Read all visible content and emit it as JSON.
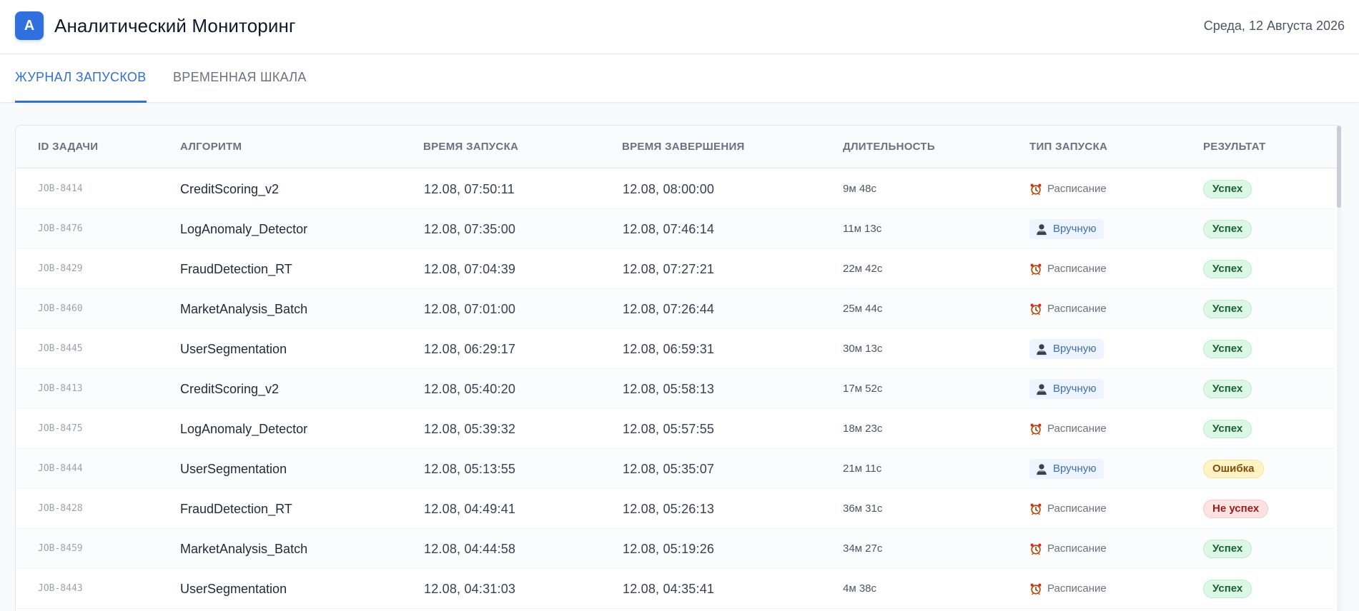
{
  "app": {
    "logo_letter": "А",
    "title": "Аналитический Мониторинг",
    "date": "Среда, 12 Августа 2026"
  },
  "tabs": [
    {
      "label": "ЖУРНАЛ ЗАПУСКОВ",
      "active": true
    },
    {
      "label": "ВРЕМЕННАЯ ШКАЛА",
      "active": false
    }
  ],
  "table": {
    "headers": [
      "ID ЗАДАЧИ",
      "АЛГОРИТМ",
      "ВРЕМЯ ЗАПУСКА",
      "ВРЕМЯ ЗАВЕРШЕНИЯ",
      "ДЛИТЕЛЬНОСТЬ",
      "ТИП ЗАПУСКА",
      "РЕЗУЛЬТАТ"
    ],
    "rows": [
      {
        "id": "JOB-8414",
        "algorithm": "CreditScoring_v2",
        "start": "12.08, 07:50:11",
        "end": "12.08, 08:00:00",
        "duration": "9м 48с",
        "type": "Расписание",
        "type_kind": "schedule",
        "result": "Успех",
        "result_kind": "success"
      },
      {
        "id": "JOB-8476",
        "algorithm": "LogAnomaly_Detector",
        "start": "12.08, 07:35:00",
        "end": "12.08, 07:46:14",
        "duration": "11м 13с",
        "type": "Вручную",
        "type_kind": "manual",
        "result": "Успех",
        "result_kind": "success"
      },
      {
        "id": "JOB-8429",
        "algorithm": "FraudDetection_RT",
        "start": "12.08, 07:04:39",
        "end": "12.08, 07:27:21",
        "duration": "22м 42с",
        "type": "Расписание",
        "type_kind": "schedule",
        "result": "Успех",
        "result_kind": "success"
      },
      {
        "id": "JOB-8460",
        "algorithm": "MarketAnalysis_Batch",
        "start": "12.08, 07:01:00",
        "end": "12.08, 07:26:44",
        "duration": "25м 44с",
        "type": "Расписание",
        "type_kind": "schedule",
        "result": "Успех",
        "result_kind": "success"
      },
      {
        "id": "JOB-8445",
        "algorithm": "UserSegmentation",
        "start": "12.08, 06:29:17",
        "end": "12.08, 06:59:31",
        "duration": "30м 13с",
        "type": "Вручную",
        "type_kind": "manual",
        "result": "Успех",
        "result_kind": "success"
      },
      {
        "id": "JOB-8413",
        "algorithm": "CreditScoring_v2",
        "start": "12.08, 05:40:20",
        "end": "12.08, 05:58:13",
        "duration": "17м 52с",
        "type": "Вручную",
        "type_kind": "manual",
        "result": "Успех",
        "result_kind": "success"
      },
      {
        "id": "JOB-8475",
        "algorithm": "LogAnomaly_Detector",
        "start": "12.08, 05:39:32",
        "end": "12.08, 05:57:55",
        "duration": "18м 23с",
        "type": "Расписание",
        "type_kind": "schedule",
        "result": "Успех",
        "result_kind": "success"
      },
      {
        "id": "JOB-8444",
        "algorithm": "UserSegmentation",
        "start": "12.08, 05:13:55",
        "end": "12.08, 05:35:07",
        "duration": "21м 11с",
        "type": "Вручную",
        "type_kind": "manual",
        "result": "Ошибка",
        "result_kind": "error"
      },
      {
        "id": "JOB-8428",
        "algorithm": "FraudDetection_RT",
        "start": "12.08, 04:49:41",
        "end": "12.08, 05:26:13",
        "duration": "36м 31с",
        "type": "Расписание",
        "type_kind": "schedule",
        "result": "Не успех",
        "result_kind": "fail"
      },
      {
        "id": "JOB-8459",
        "algorithm": "MarketAnalysis_Batch",
        "start": "12.08, 04:44:58",
        "end": "12.08, 05:19:26",
        "duration": "34м 27с",
        "type": "Расписание",
        "type_kind": "schedule",
        "result": "Успех",
        "result_kind": "success"
      },
      {
        "id": "JOB-8443",
        "algorithm": "UserSegmentation",
        "start": "12.08, 04:31:03",
        "end": "12.08, 04:35:41",
        "duration": "4м 38с",
        "type": "Расписание",
        "type_kind": "schedule",
        "result": "Успех",
        "result_kind": "success"
      }
    ]
  },
  "icons": {
    "schedule": "alarm-clock-icon",
    "manual": "user-icon"
  },
  "colors": {
    "accent": "#2f6fe0",
    "success_bg": "#dcf7e6",
    "error_bg": "#fdf3c4",
    "fail_bg": "#fde2e2"
  }
}
